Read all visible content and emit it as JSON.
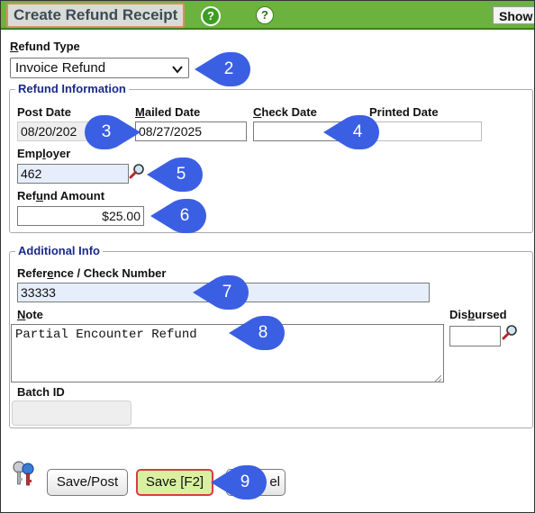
{
  "window": {
    "title": "Create Refund Receipt",
    "show_label": "Show",
    "help_glyph": "?"
  },
  "refund_type": {
    "label_prefix": "",
    "label_ul": "R",
    "label_rest": "efund Type",
    "value": "Invoice Refund"
  },
  "refund_info": {
    "legend": "Refund Information",
    "post_date_label": "Post Date",
    "post_date_value": "08/20/202",
    "mailed_date_label_ul": "M",
    "mailed_date_label_rest": "ailed Date",
    "mailed_date_value": "08/27/2025",
    "check_date_label_ul": "C",
    "check_date_label_rest": "heck Date",
    "check_date_value": "",
    "printed_date_label": "Printed Date",
    "printed_date_value": "",
    "employer_label_pre": "Emp",
    "employer_label_ul": "l",
    "employer_label_rest": "oyer",
    "employer_value": "462",
    "refund_amount_label_pre": "Ref",
    "refund_amount_label_ul": "u",
    "refund_amount_label_rest": "nd Amount",
    "refund_amount_value": "$25.00"
  },
  "additional_info": {
    "legend": "Additional Info",
    "reference_label_pre": "Refer",
    "reference_label_ul": "e",
    "reference_label_rest": "nce / Check Number",
    "reference_value": "33333",
    "note_label_ul": "N",
    "note_label_rest": "ote",
    "note_value": "Partial Encounter Refund",
    "disbursed_label_pre": "Dis",
    "disbursed_label_ul": "b",
    "disbursed_label_rest": "ursed",
    "disbursed_value": "",
    "batch_label": "Batch ID",
    "batch_value": ""
  },
  "buttons": {
    "save_post": "Save/Post",
    "save": "Save [F2]",
    "cancel_visible": "el"
  },
  "markers": [
    "2",
    "3",
    "4",
    "5",
    "6",
    "7",
    "8",
    "9"
  ],
  "colors": {
    "title_bar": "#6bb33e",
    "marker": "#3b5fe3",
    "legend_text": "#1a2a8a",
    "save_button": "#d8f0a0",
    "save_border": "#d83b47"
  },
  "icons": {
    "lookup": "magnifier-icon",
    "keys": "keys-icon",
    "help": "help-icon"
  }
}
